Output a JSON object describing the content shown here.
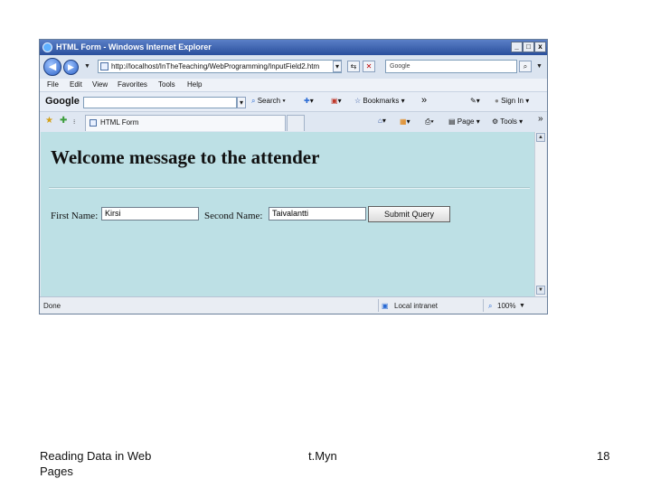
{
  "window": {
    "title": "HTML Form - Windows Internet Explorer",
    "minimize": "_",
    "maximize": "□",
    "close": "x"
  },
  "address": {
    "url": "http://localhost/InTheTeaching/WebProgramming/InputField2.htm",
    "search_placeholder": "Google"
  },
  "menu": {
    "items": [
      "File",
      "Edit",
      "View",
      "Favorites",
      "Tools",
      "Help"
    ]
  },
  "google_toolbar": {
    "logo": "Google",
    "search": "Search",
    "bookmarks": "Bookmarks",
    "more": "»",
    "sign_in": "Sign In"
  },
  "tab": {
    "label": "HTML Form",
    "page": "Page",
    "tools": "Tools",
    "more": "»"
  },
  "page": {
    "heading": "Welcome message to the attender",
    "first_name_label": "First Name:",
    "first_name_value": "Kirsi",
    "second_name_label": "Second Name:",
    "second_name_value": "Taivalantti",
    "submit_label": "Submit Query"
  },
  "status": {
    "text": "Done",
    "zone": "Local intranet",
    "zoom": "100%"
  },
  "slide_footer": {
    "left_line1": "Reading Data in Web",
    "left_line2": "Pages",
    "center": "t.Myn",
    "page_number": "18"
  }
}
